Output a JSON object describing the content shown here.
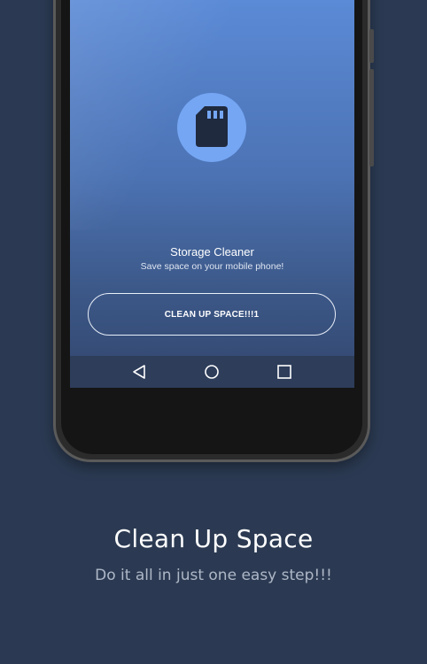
{
  "app": {
    "title": "Storage Cleaner",
    "subtitle": "Save space on your mobile phone!",
    "action_label": "CLEAN UP SPACE!!!1",
    "icon": "sd-card-icon",
    "colors": {
      "background": "#2b3a52",
      "screen_top": "#5b8ad6",
      "screen_bottom": "#32466d",
      "icon_circle": "#75a6f4",
      "icon_glyph": "#1f2a3f"
    }
  },
  "navbar": {
    "back_icon": "back-triangle-icon",
    "home_icon": "home-circle-icon",
    "recents_icon": "recents-square-icon"
  },
  "promo": {
    "headline": "Clean Up Space",
    "tagline": "Do it all in just one easy step!!!"
  }
}
